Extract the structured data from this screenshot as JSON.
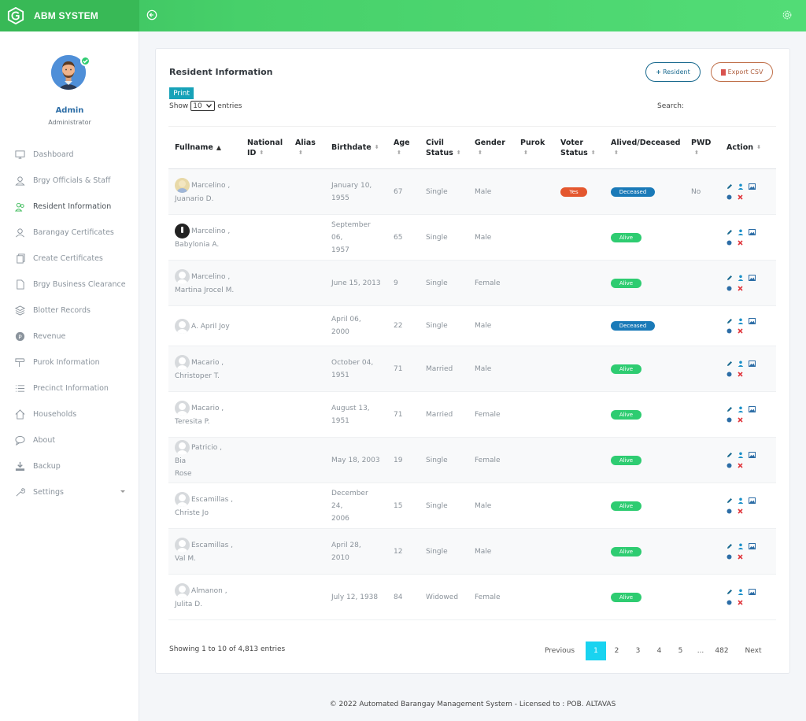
{
  "app": {
    "name": "ABM SYSTEM"
  },
  "user": {
    "name": "Admin",
    "role": "Administrator"
  },
  "sidebar": {
    "items": [
      {
        "label": "Dashboard",
        "icon": "monitor-icon"
      },
      {
        "label": "Brgy Officials & Staff",
        "icon": "user-icon"
      },
      {
        "label": "Resident Information",
        "icon": "users-icon"
      },
      {
        "label": "Barangay Certificates",
        "icon": "user-group-icon"
      },
      {
        "label": "Create Certificates",
        "icon": "copy-icon"
      },
      {
        "label": "Brgy Business Clearance",
        "icon": "file-icon"
      },
      {
        "label": "Blotter Records",
        "icon": "layers-icon"
      },
      {
        "label": "Revenue",
        "icon": "coin-icon"
      },
      {
        "label": "Purok Information",
        "icon": "signpost-icon"
      },
      {
        "label": "Precinct Information",
        "icon": "list-icon"
      },
      {
        "label": "Households",
        "icon": "home-icon"
      },
      {
        "label": "About",
        "icon": "chat-icon"
      },
      {
        "label": "Backup",
        "icon": "download-icon"
      },
      {
        "label": "Settings",
        "icon": "wrench-icon"
      }
    ]
  },
  "page": {
    "title": "Resident Information",
    "resident_button": "Resident",
    "export_button": "Export CSV",
    "print_button": "Print",
    "show_label": "Show",
    "entries_value": "10",
    "entries_label": "entries",
    "search_label": "Search:"
  },
  "table": {
    "headers": {
      "fullname": "Fullname",
      "national_id_1": "National",
      "national_id_2": "ID",
      "alias": "Alias",
      "birthdate": "Birthdate",
      "age": "Age",
      "civil_1": "Civil",
      "civil_2": "Status",
      "gender": "Gender",
      "purok": "Purok",
      "voter_1": "Voter",
      "voter_2": "Status",
      "alived": "Alived/Deceased",
      "pwd": "PWD",
      "action": "Action"
    },
    "rows": [
      {
        "name1": "Marcelino ,",
        "name2": "Juanario D.",
        "birth1": "January 10,",
        "birth2": "1955",
        "age": "67",
        "civil": "Single",
        "gender": "Male",
        "voter": "Yes",
        "status": "Deceased",
        "pwd": "No",
        "avatar": "photo"
      },
      {
        "name1": "Marcelino ,",
        "name2": "Babylonia A.",
        "birth1": "September 06,",
        "birth2": "1957",
        "age": "65",
        "civil": "Single",
        "gender": "Male",
        "voter": "",
        "status": "Alive",
        "pwd": "",
        "avatar": "dark"
      },
      {
        "name1": "Marcelino ,",
        "name2": "Martina Jrocel M.",
        "birth1": "June 15, 2013",
        "birth2": "",
        "age": "9",
        "civil": "Single",
        "gender": "Female",
        "voter": "",
        "status": "Alive",
        "pwd": "",
        "avatar": "default"
      },
      {
        "name1": "A. April Joy",
        "name2": "",
        "birth1": "April 06, 2000",
        "birth2": "",
        "age": "22",
        "civil": "Single",
        "gender": "Male",
        "voter": "",
        "status": "Deceased",
        "pwd": "",
        "avatar": "default"
      },
      {
        "name1": "Macario ,",
        "name2": "Christoper T.",
        "birth1": "October 04,",
        "birth2": "1951",
        "age": "71",
        "civil": "Married",
        "gender": "Male",
        "voter": "",
        "status": "Alive",
        "pwd": "",
        "avatar": "default"
      },
      {
        "name1": "Macario ,",
        "name2": "Teresita P.",
        "birth1": "August 13,",
        "birth2": "1951",
        "age": "71",
        "civil": "Married",
        "gender": "Female",
        "voter": "",
        "status": "Alive",
        "pwd": "",
        "avatar": "default"
      },
      {
        "name1": "Patricio , Bia",
        "name2": "Rose",
        "birth1": "May 18, 2003",
        "birth2": "",
        "age": "19",
        "civil": "Single",
        "gender": "Female",
        "voter": "",
        "status": "Alive",
        "pwd": "",
        "avatar": "default"
      },
      {
        "name1": "Escamillas ,",
        "name2": "Christe Jo",
        "birth1": "December 24,",
        "birth2": "2006",
        "age": "15",
        "civil": "Single",
        "gender": "Male",
        "voter": "",
        "status": "Alive",
        "pwd": "",
        "avatar": "default"
      },
      {
        "name1": "Escamillas ,",
        "name2": "Val M.",
        "birth1": "April 28, 2010",
        "birth2": "",
        "age": "12",
        "civil": "Single",
        "gender": "Male",
        "voter": "",
        "status": "Alive",
        "pwd": "",
        "avatar": "default"
      },
      {
        "name1": "Almanon ,",
        "name2": "Julita D.",
        "birth1": "July 12, 1938",
        "birth2": "",
        "age": "84",
        "civil": "Widowed",
        "gender": "Female",
        "voter": "",
        "status": "Alive",
        "pwd": "",
        "avatar": "default"
      }
    ]
  },
  "pagination": {
    "info": "Showing 1 to 10 of 4,813 entries",
    "previous": "Previous",
    "pages": [
      "1",
      "2",
      "3",
      "4",
      "5",
      "...",
      "482"
    ],
    "active": "1",
    "next": "Next"
  },
  "footer": {
    "text": "© 2022 Automated Barangay Management System - Licensed to : POB. ALTAVAS"
  },
  "colors": {
    "brand": "#38b956",
    "alive": "#2ecc71",
    "deceased": "#1a7ab8",
    "yes": "#e4572e",
    "active_page": "#19d3f0"
  }
}
